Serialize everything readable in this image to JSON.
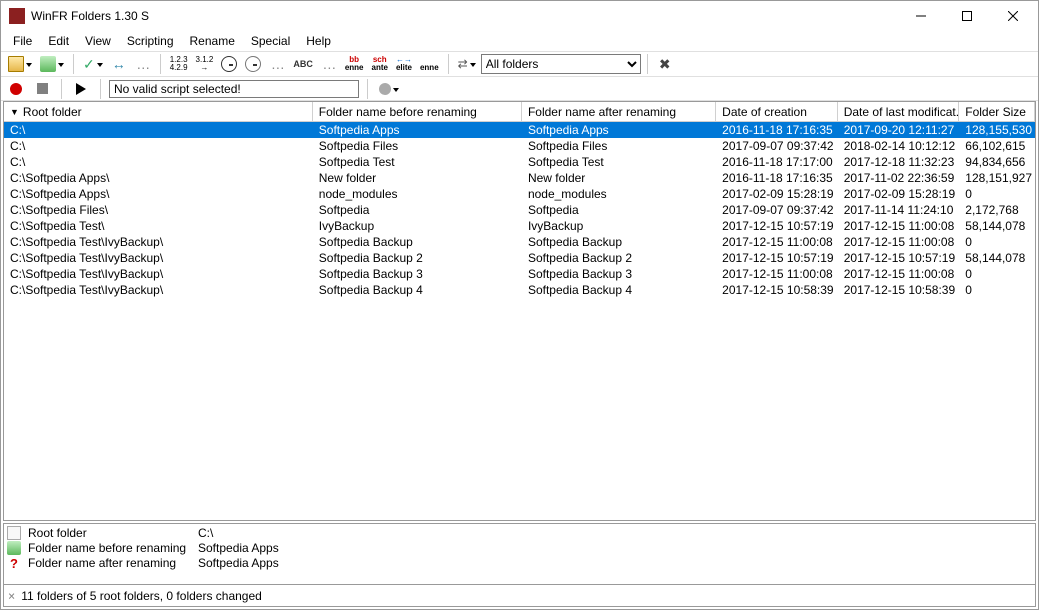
{
  "window": {
    "title": "WinFR Folders 1.30 S"
  },
  "menu": {
    "items": [
      "File",
      "Edit",
      "View",
      "Scripting",
      "Rename",
      "Special",
      "Help"
    ]
  },
  "toolbar": {
    "folders_filter": "All folders"
  },
  "script": {
    "status": "No valid script selected!"
  },
  "columns": [
    "Root folder",
    "Folder name before renaming",
    "Folder name after renaming",
    "Date of creation",
    "Date of last modificat...",
    "Folder Size"
  ],
  "rows": [
    {
      "root": "C:\\",
      "before": "Softpedia Apps",
      "after": "Softpedia Apps",
      "created": "2016-11-18 17:16:35",
      "modified": "2017-09-20 12:11:27",
      "size": "128,155,530",
      "selected": true
    },
    {
      "root": "C:\\",
      "before": "Softpedia Files",
      "after": "Softpedia Files",
      "created": "2017-09-07 09:37:42",
      "modified": "2018-02-14 10:12:12",
      "size": "66,102,615"
    },
    {
      "root": "C:\\",
      "before": "Softpedia Test",
      "after": "Softpedia Test",
      "created": "2016-11-18 17:17:00",
      "modified": "2017-12-18 11:32:23",
      "size": "94,834,656"
    },
    {
      "root": "C:\\Softpedia Apps\\",
      "before": "New folder",
      "after": "New folder",
      "created": "2016-11-18 17:16:35",
      "modified": "2017-11-02 22:36:59",
      "size": "128,151,927"
    },
    {
      "root": "C:\\Softpedia Apps\\",
      "before": "node_modules",
      "after": "node_modules",
      "created": "2017-02-09 15:28:19",
      "modified": "2017-02-09 15:28:19",
      "size": "0"
    },
    {
      "root": "C:\\Softpedia Files\\",
      "before": "Softpedia",
      "after": "Softpedia",
      "created": "2017-09-07 09:37:42",
      "modified": "2017-11-14 11:24:10",
      "size": "2,172,768"
    },
    {
      "root": "C:\\Softpedia Test\\",
      "before": "IvyBackup",
      "after": "IvyBackup",
      "created": "2017-12-15 10:57:19",
      "modified": "2017-12-15 11:00:08",
      "size": "58,144,078"
    },
    {
      "root": "C:\\Softpedia Test\\IvyBackup\\",
      "before": "Softpedia Backup",
      "after": "Softpedia Backup",
      "created": "2017-12-15 11:00:08",
      "modified": "2017-12-15 11:00:08",
      "size": "0"
    },
    {
      "root": "C:\\Softpedia Test\\IvyBackup\\",
      "before": "Softpedia Backup 2",
      "after": "Softpedia Backup 2",
      "created": "2017-12-15 10:57:19",
      "modified": "2017-12-15 10:57:19",
      "size": "58,144,078"
    },
    {
      "root": "C:\\Softpedia Test\\IvyBackup\\",
      "before": "Softpedia Backup 3",
      "after": "Softpedia Backup 3",
      "created": "2017-12-15 11:00:08",
      "modified": "2017-12-15 11:00:08",
      "size": "0"
    },
    {
      "root": "C:\\Softpedia Test\\IvyBackup\\",
      "before": "Softpedia Backup 4",
      "after": "Softpedia Backup 4",
      "created": "2017-12-15 10:58:39",
      "modified": "2017-12-15 10:58:39",
      "size": "0"
    }
  ],
  "detail": {
    "labels": [
      "Root folder",
      "Folder name before renaming",
      "Folder name after renaming"
    ],
    "values": [
      "C:\\",
      "Softpedia Apps",
      "Softpedia Apps"
    ]
  },
  "status": {
    "text": "11 folders of 5 root folders, 0 folders changed"
  }
}
